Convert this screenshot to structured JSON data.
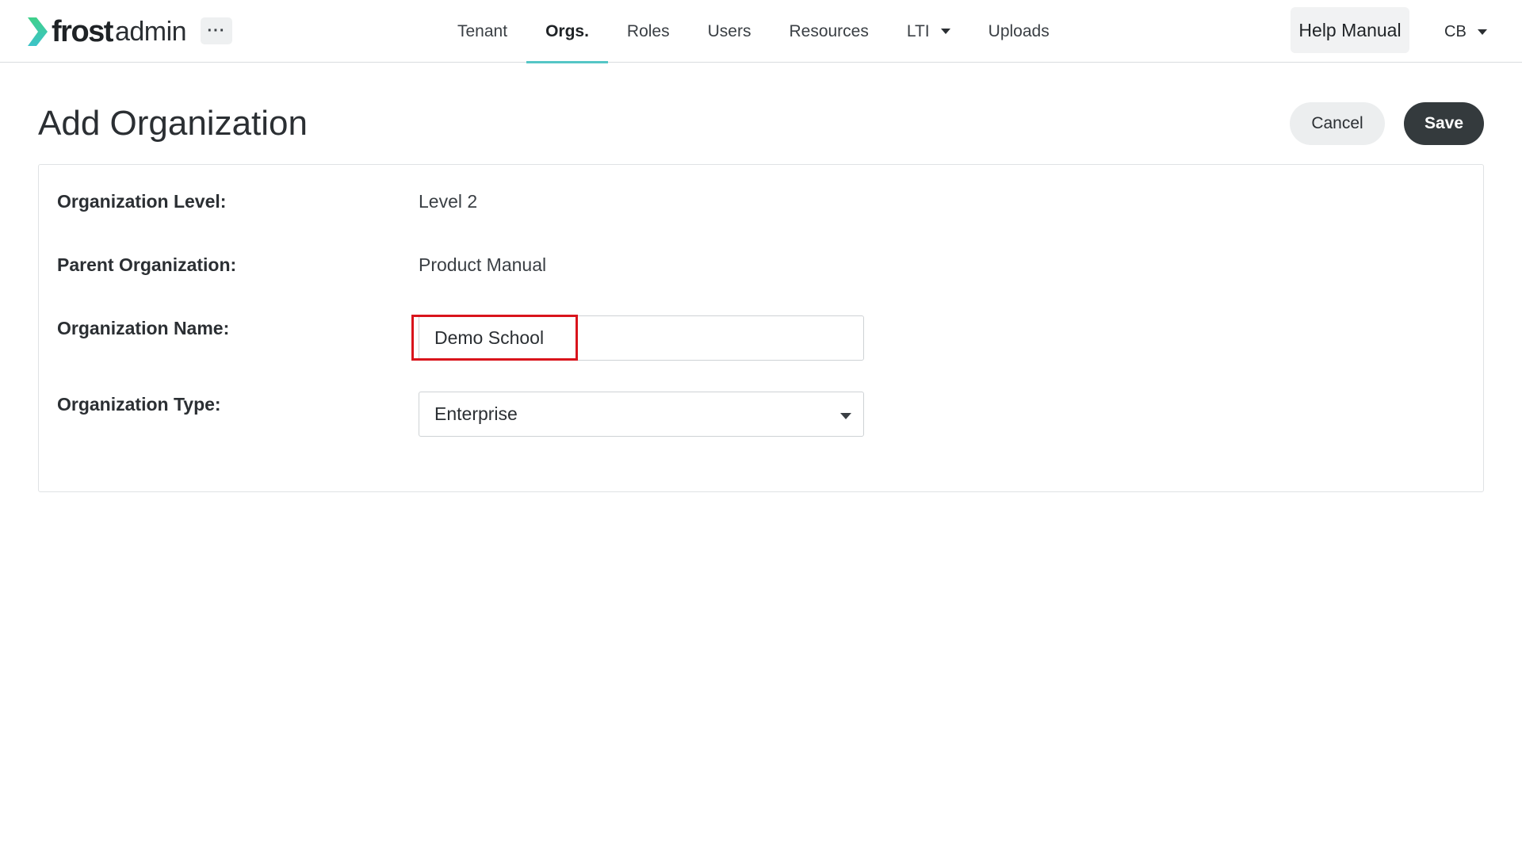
{
  "app": {
    "logo_word_1": "frost",
    "logo_word_2": "admin",
    "more_label": "···"
  },
  "nav": {
    "items": [
      {
        "label": "Tenant"
      },
      {
        "label": "Orgs."
      },
      {
        "label": "Roles"
      },
      {
        "label": "Users"
      },
      {
        "label": "Resources"
      },
      {
        "label": "LTI"
      },
      {
        "label": "Uploads"
      }
    ],
    "active": "Orgs.",
    "help_label": "Help Manual",
    "user_initials": "CB"
  },
  "page": {
    "title": "Add Organization",
    "cancel_label": "Cancel",
    "save_label": "Save"
  },
  "form": {
    "level_label": "Organization Level:",
    "level_value": "Level 2",
    "parent_label": "Parent Organization:",
    "parent_value": "Product Manual",
    "name_label": "Organization Name:",
    "name_value": "Demo School",
    "type_label": "Organization Type:",
    "type_value": "Enterprise"
  },
  "colors": {
    "accent": "#55c6c6",
    "logo_green": "#2fc27a",
    "highlight": "#d9141c",
    "save_button": "#343a3d"
  },
  "icons": {
    "logo": "frost-chevron-logo-icon",
    "more": "ellipsis-icon",
    "dropdown": "caret-down-icon"
  }
}
